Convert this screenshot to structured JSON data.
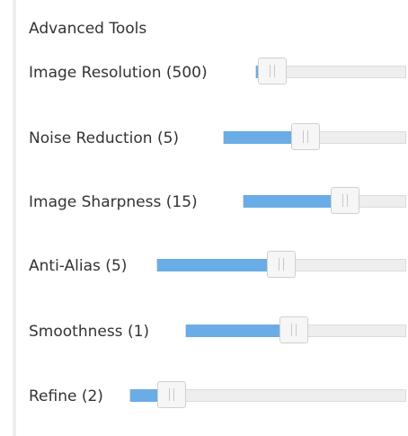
{
  "panel": {
    "title": "Advanced Tools",
    "accent_color": "#6aace6",
    "sliders": [
      {
        "label": "Image Resolution (500)",
        "value_fraction": 0.11
      },
      {
        "label": "Noise Reduction (5)",
        "value_fraction": 0.45
      },
      {
        "label": "Image Sharpness (15)",
        "value_fraction": 0.63
      },
      {
        "label": "Anti-Alias (5)",
        "value_fraction": 0.5
      },
      {
        "label": "Smoothness (1)",
        "value_fraction": 0.49
      },
      {
        "label": "Refine (2)",
        "value_fraction": 0.15
      }
    ]
  }
}
